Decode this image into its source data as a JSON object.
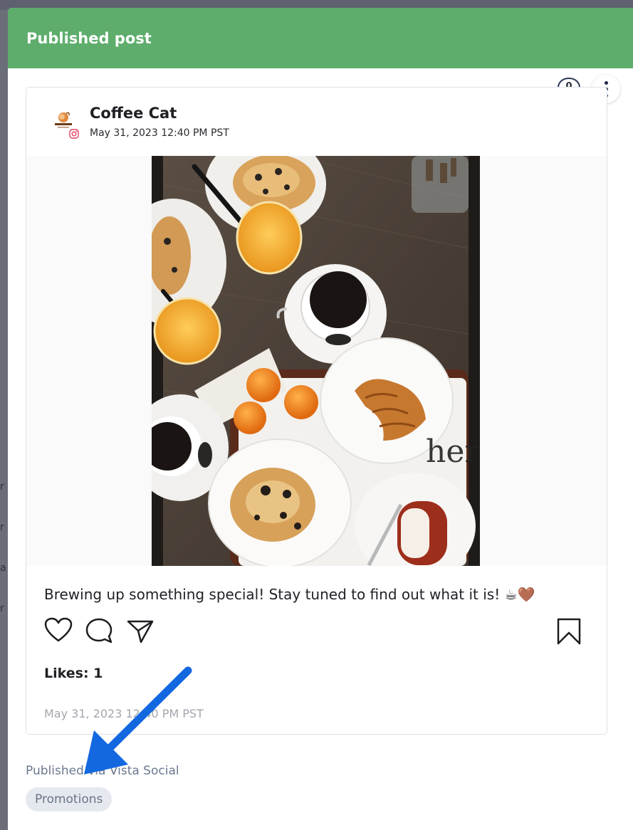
{
  "modal": {
    "title": "Published post",
    "header_color": "#5ead6c",
    "comment_count": "0"
  },
  "post": {
    "profile_name": "Coffee Cat",
    "network_icon": "instagram-icon",
    "timestamp": "May 31, 2023 12:40 PM PST",
    "caption": "Brewing up something special! Stay tuned to find out what it is! ☕🤎",
    "likes": "Likes: 1",
    "footer_timestamp": "May 31, 2023 12:40 PM PST",
    "image_description": "coffee-and-pastries-photo"
  },
  "publish_info": "Published via Vista Social",
  "labels": [
    "Promotions"
  ],
  "annotation_color": "#1368e0"
}
